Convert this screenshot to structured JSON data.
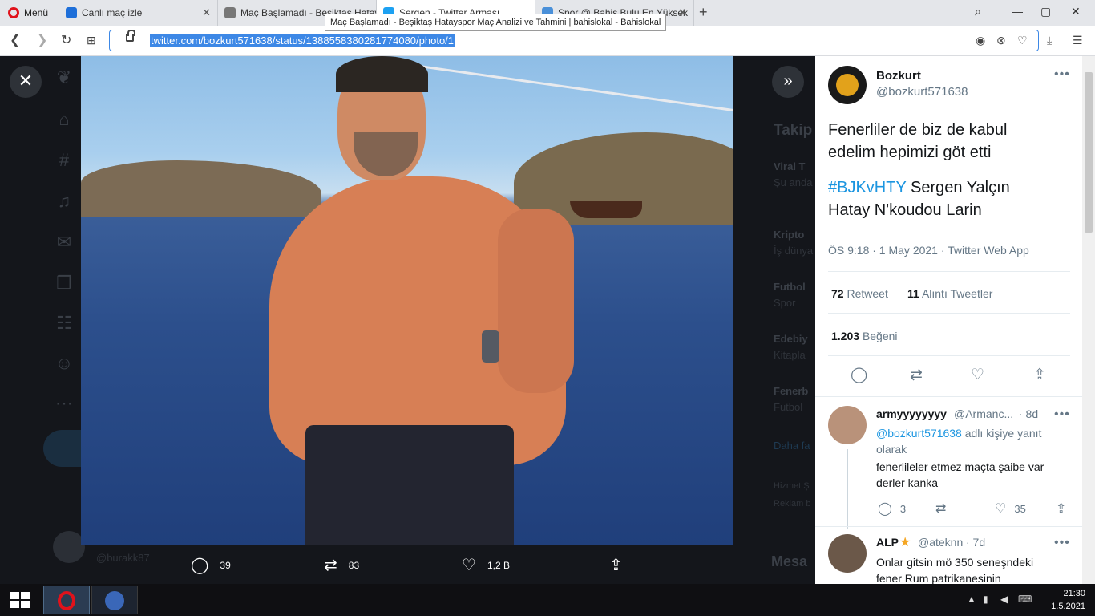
{
  "browser": {
    "menu_label": "Menü",
    "tabs": [
      {
        "title": "Canlı maç izle",
        "color": "#1e6fd9"
      },
      {
        "title": "Maç Başlamadı - Beşiktaş Hatay...",
        "color": "#555"
      },
      {
        "title": "Sergen - Twitter Arması",
        "color": "#1da1f2"
      },
      {
        "title": "Spor @ Bahis Bulu En Yüksek",
        "color": "#4a90d9"
      }
    ],
    "new_tab": "+",
    "tooltip": "Maç Başlamadı - Beşiktaş Hatayspor Maç Analizi ve Tahmini | bahislokal - Bahislokal",
    "url": "twitter.com/bozkurt571638/status/1388558380281774080/photo/1",
    "window_buttons": [
      "—",
      "▢",
      "✕"
    ]
  },
  "photo_actions": {
    "replies": "39",
    "retweets": "83",
    "likes": "1,2 B"
  },
  "background": {
    "items": [
      {
        "title": "Takip",
        "sub": ""
      },
      {
        "title": "Viral T",
        "sub": "Şu anda"
      },
      {
        "title": "Kripto",
        "sub": "İş dünya"
      },
      {
        "title": "Futbol",
        "sub": "Spor"
      },
      {
        "title": "Edebiy",
        "sub": "Kitapla"
      },
      {
        "title": "Fenerb",
        "sub": "Futbol"
      }
    ],
    "more_link": "Daha fa",
    "footer1": "Hizmet Ş",
    "footer2": "Reklam b",
    "messages": "Mesa",
    "bottom_user": "@burakk87"
  },
  "tweet": {
    "name": "Bozkurt",
    "handle": "@bozkurt571638",
    "text_line1": "Fenerliler de biz de kabul",
    "text_line2": "edelim hepimizi göt etti",
    "hashtag": "#BJKvHTY",
    "text_line3_rest": " Sergen Yalçın",
    "text_line4": "Hatay N'koudou Larin",
    "meta": "ÖS 9:18 · 1 May 2021 · Twitter Web App",
    "retweet_count": "72",
    "retweet_label": "Retweet",
    "quote_count": "11",
    "quote_label": "Alıntı Tweetler",
    "like_count": "1.203",
    "like_label": "Beğeni"
  },
  "replies": [
    {
      "name": "armyyyyyyyy",
      "handle": "@Armanc...",
      "time": "· 8d",
      "reply_to_handle": "@bozkurt571638",
      "reply_to_suffix": "adlı kişiye yanıt",
      "reply_to_line2": "olarak",
      "text1": "fenerlileler etmez maçta şaibe var",
      "text2": "derler kanka",
      "reply_count": "3",
      "like_count": "35"
    },
    {
      "name": "ALP",
      "handle": "@ateknn",
      "time": "· 7d",
      "text1": "Onlar gitsin mö 350 seneşndeki",
      "text2": "fener Rum patrikanesinin"
    }
  ],
  "taskbar": {
    "time": "21:30",
    "date": "1.5.2021"
  }
}
